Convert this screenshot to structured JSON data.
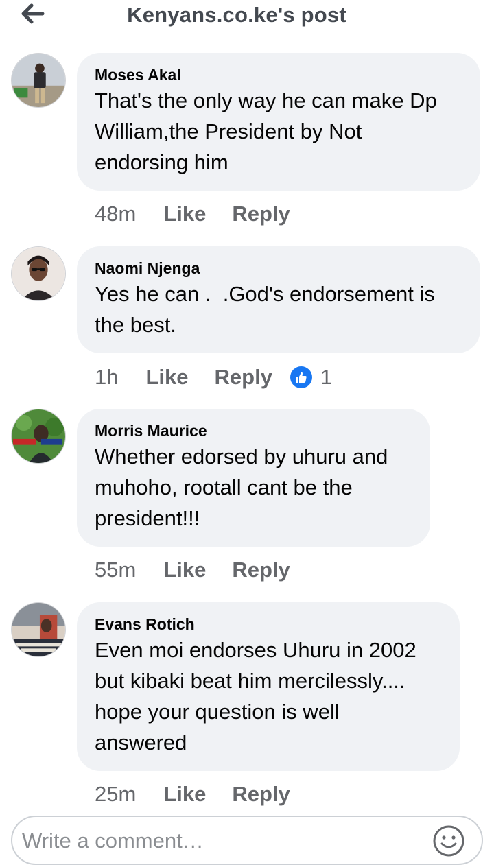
{
  "header": {
    "title": "Kenyans.co.ke's post",
    "back_icon": "arrow-left-icon"
  },
  "comments": [
    {
      "author": "Moses Akal",
      "text": "That's the only way he can make Dp\nWilliam,the President by Not\nendorsing him",
      "time": "48m",
      "like": "Like",
      "reply": "Reply"
    },
    {
      "author": "Naomi Njenga",
      "text": "Yes he can .  .God's endorsement is\nthe best.",
      "time": "1h",
      "like": "Like",
      "reply": "Reply",
      "reaction_count": "1",
      "reaction_icon": "thumbs-up-icon"
    },
    {
      "author": "Morris Maurice",
      "text": "Whether edorsed by uhuru and\nmuhoho, rootall cant be the\npresident!!!",
      "time": "55m",
      "like": "Like",
      "reply": "Reply"
    },
    {
      "author": "Evans Rotich",
      "text": "Even moi endorses Uhuru in 2002\nbut kibaki beat him mercilessly....\nhope your question is well\nanswered",
      "time": "25m",
      "like": "Like",
      "reply": "Reply"
    }
  ],
  "composer": {
    "placeholder": "Write a comment…",
    "emoji_icon": "smiley-icon"
  },
  "colors": {
    "bubble": "#f0f2f5",
    "secondary_text": "#65676b",
    "like_blue": "#1877f2"
  }
}
